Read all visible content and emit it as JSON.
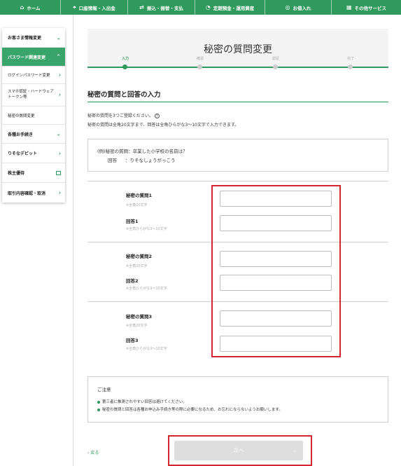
{
  "nav": [
    {
      "label": "ホーム",
      "icon": "home-icon"
    },
    {
      "label": "口座情報・入出金",
      "icon": "bank-icon"
    },
    {
      "label": "振込・振替・支払",
      "icon": "transfer-icon"
    },
    {
      "label": "定期預金・運用資産",
      "icon": "piggy-bank-icon"
    },
    {
      "label": "お借入れ",
      "icon": "loan-icon"
    },
    {
      "label": "その他サービス",
      "icon": "grid-icon"
    }
  ],
  "sidebar": {
    "items": [
      {
        "label": "お客さま情報変更"
      },
      {
        "label": "パスワード関連変更"
      },
      {
        "label": "ログインパスワード変更"
      },
      {
        "label": "スマホ認証・ハードウェアトークン等"
      },
      {
        "label": "秘密の質問変更"
      },
      {
        "label": "各種お手続き"
      },
      {
        "label": "りそなデビット"
      },
      {
        "label": "株主優待"
      },
      {
        "label": "取引内容確認・取消"
      }
    ]
  },
  "page": {
    "title": "秘密の質問変更",
    "steps": [
      "入力",
      "確認",
      "認証",
      "完了"
    ],
    "section_title": "秘密の質問と回答の入力",
    "note_line1": "秘密の質問を3つご登録ください。",
    "note_line2": "秘密の質問は全角20文字まで、回答は全角ひらがな3～10文字で入力できます。",
    "help_glyph": "?",
    "example": {
      "q_label": "(例)秘密の質問：卒業した小学校の名前は？",
      "a_label": "回答",
      "a_value": "：りそなしょうがっこう"
    },
    "questions": [
      {
        "q_label": "秘密の質問1",
        "q_hint": "※全角20文字",
        "a_label": "回答1",
        "a_hint": "※全角ひらがな3～10文字",
        "q_value": "",
        "a_value": ""
      },
      {
        "q_label": "秘密の質問2",
        "q_hint": "※全角20文字",
        "a_label": "回答2",
        "a_hint": "※全角ひらがな3～10文字",
        "q_value": "",
        "a_value": ""
      },
      {
        "q_label": "秘密の質問3",
        "q_hint": "※全角20文字",
        "a_label": "回答3",
        "a_hint": "※全角ひらがな3～10文字",
        "q_value": "",
        "a_value": ""
      }
    ],
    "caution": {
      "title": "ご注意",
      "items": [
        "第三者に推測されやすい回答は避けてください。",
        "秘密の質問と回答は各種お申込み手続き等の際に必要になるため、お忘れにならないようお願いします。"
      ]
    },
    "back_label": "戻る",
    "next_label": "次へ"
  },
  "colors": {
    "brand": "#2f9a5b",
    "highlight": "#d3282f",
    "disabled": "#dedede"
  }
}
